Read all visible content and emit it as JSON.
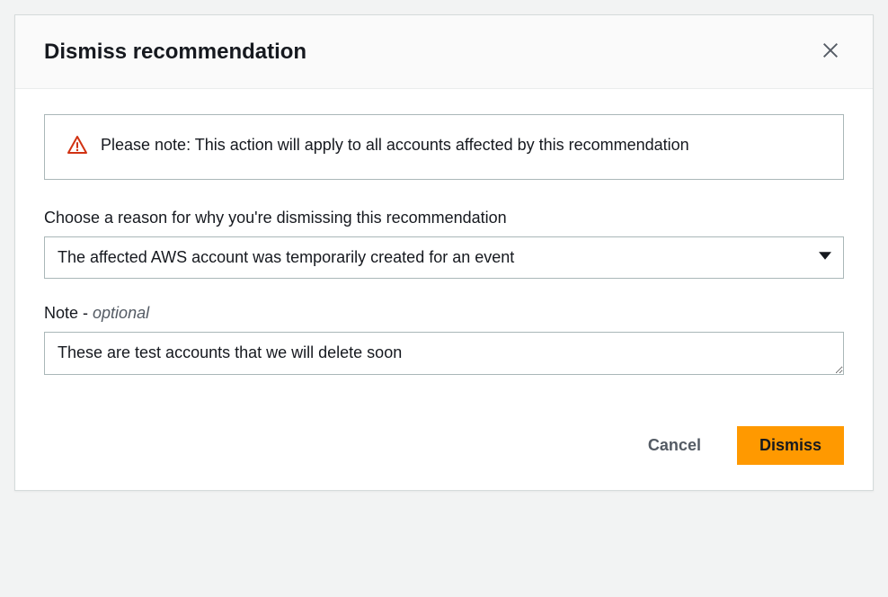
{
  "modal": {
    "title": "Dismiss recommendation",
    "alert": {
      "text": "Please note: This action will apply to all accounts affected by this recommendation"
    },
    "reason": {
      "label": "Choose a reason for why you're dismissing this recommendation",
      "selected": "The affected AWS account was temporarily created for an event"
    },
    "note": {
      "label_main": "Note",
      "label_dash": " - ",
      "label_optional": "optional",
      "value": "These are test accounts that we will delete soon"
    },
    "buttons": {
      "cancel": "Cancel",
      "dismiss": "Dismiss"
    }
  }
}
